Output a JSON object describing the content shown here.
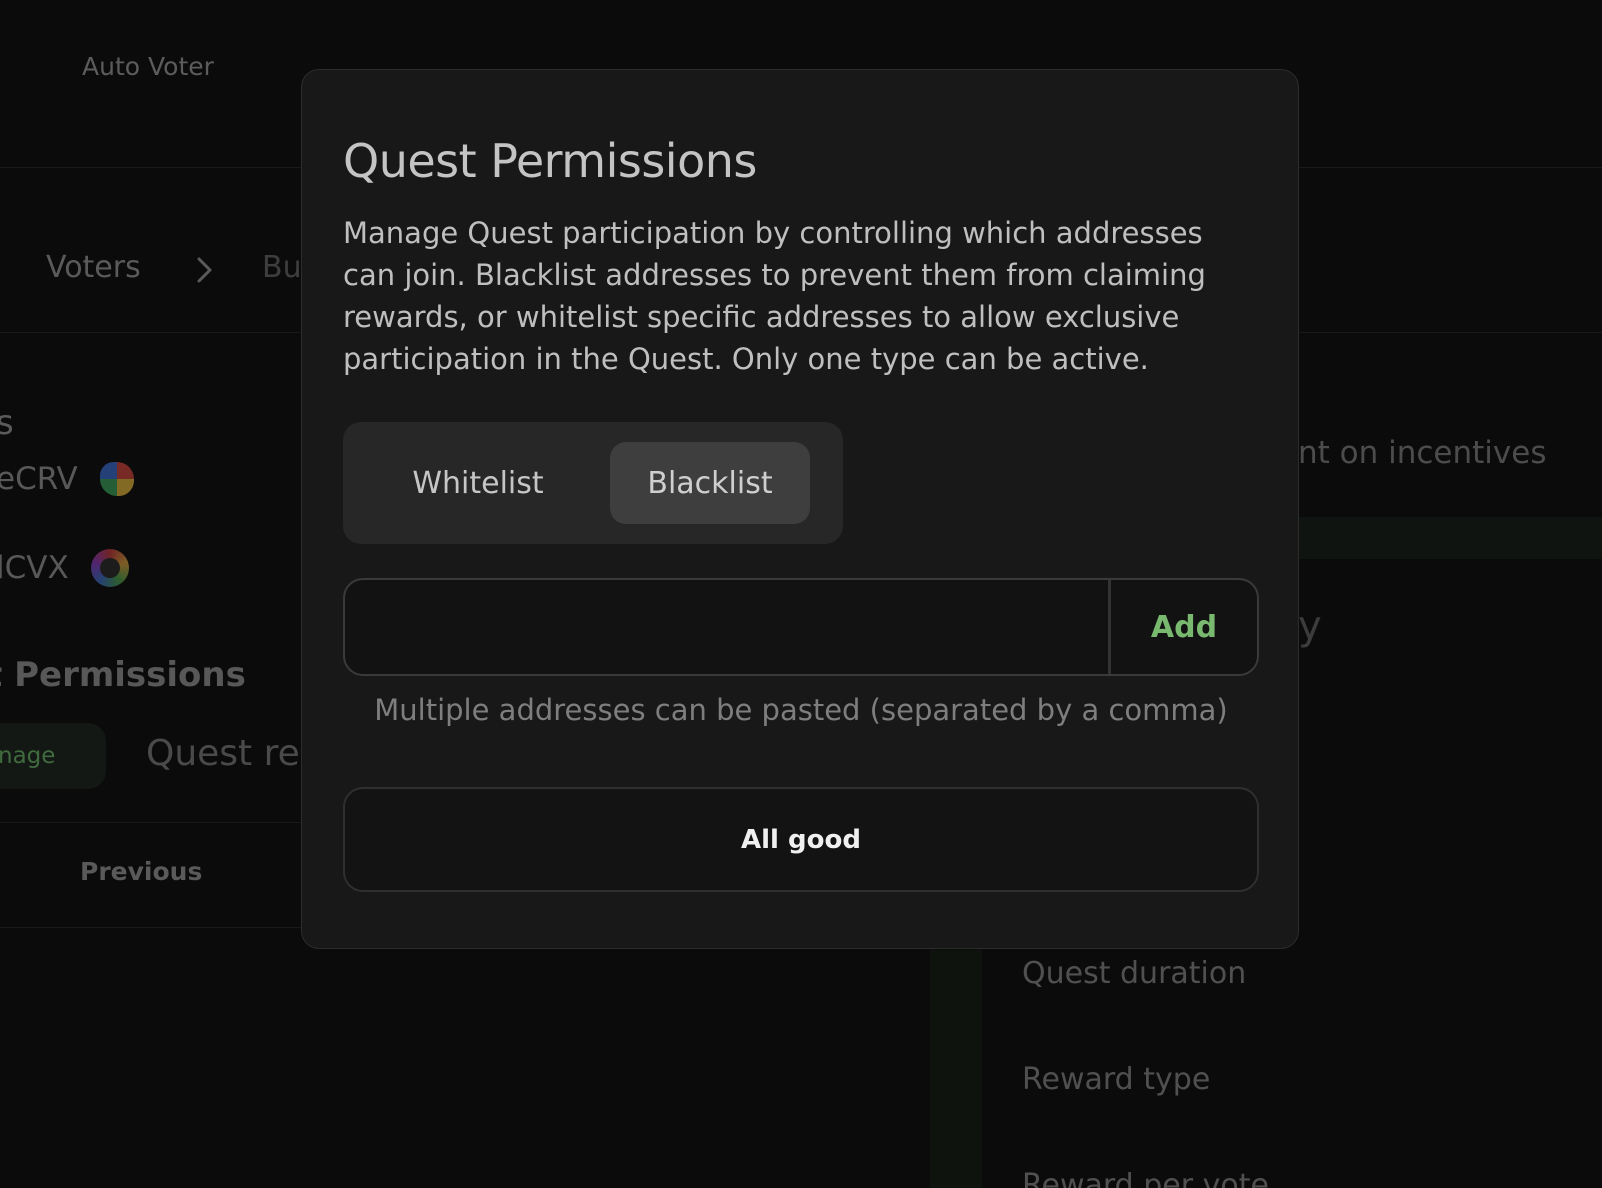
{
  "background": {
    "app_name": "Auto Voter",
    "breadcrumb": {
      "current": "Voters",
      "next": "Bu"
    },
    "left": {
      "section_fragment": "s",
      "tokens": [
        {
          "label": "eCRV",
          "icon": "curve-logo-icon"
        },
        {
          "label": "lCVX",
          "icon": "convex-logo-icon"
        }
      ],
      "permissions_heading": "t Permissions",
      "manage_button": "nage",
      "quest_rewards_fragment": "Quest rev",
      "previous_button": "Previous"
    },
    "right": {
      "incentives_fragment": "nt on incentives",
      "heading_fragment": "y"
    },
    "summary": {
      "quest_duration": "Quest duration",
      "reward_type": "Reward type",
      "reward_per_vote": "Reward per vote"
    }
  },
  "modal": {
    "title": "Quest Permissions",
    "description": "Manage Quest participation by controlling which addresses can join. Blacklist addresses to prevent them from claiming rewards, or whitelist specific addresses to allow exclusive participation in the Quest. Only one type can be active.",
    "tabs": [
      {
        "label": "Whitelist",
        "selected": false
      },
      {
        "label": "Blacklist",
        "selected": true
      }
    ],
    "address_input": {
      "value": "",
      "placeholder": ""
    },
    "add_button": "Add",
    "hint": "Multiple addresses can be pasted (separated by a comma)",
    "confirm_button": "All good"
  },
  "colors": {
    "accent_green": "#79b96f",
    "modal_bg": "#181818",
    "page_bg": "#0b0b0b"
  }
}
